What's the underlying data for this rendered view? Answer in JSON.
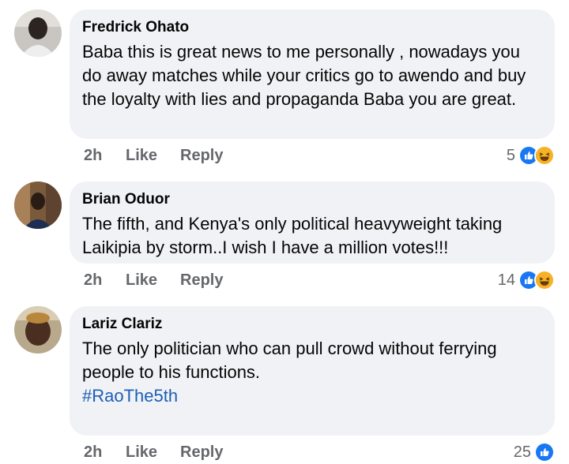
{
  "comments": [
    {
      "author": "Fredrick Ohato",
      "text": "Baba this is great news to me personally , nowadays you do away matches while your critics go to awendo and buy the loyalty with lies and propaganda Baba you are great.",
      "hashtag": "",
      "time": "2h",
      "like": "Like",
      "reply": "Reply",
      "reactions": "5",
      "reaction_icons": [
        "like-icon",
        "haha-icon"
      ]
    },
    {
      "author": "Brian Oduor",
      "text": "The fifth, and Kenya's only political heavyweight taking Laikipia by storm..I wish I have a million votes!!!",
      "hashtag": "",
      "time": "2h",
      "like": "Like",
      "reply": "Reply",
      "reactions": "14",
      "reaction_icons": [
        "like-icon",
        "haha-icon"
      ]
    },
    {
      "author": "Lariz Clariz",
      "text": "The only politician who can pull crowd without ferrying people to his functions.",
      "hashtag": "#RaoThe5th",
      "time": "2h",
      "like": "Like",
      "reply": "Reply",
      "reactions": "25",
      "reaction_icons": [
        "like-icon"
      ]
    }
  ],
  "colors": {
    "bubble": "#f0f2f5",
    "meta": "#65676b",
    "hashtag": "#1b5fb6",
    "like_blue": "#1877f2",
    "haha_yellow": "#f7b125"
  }
}
